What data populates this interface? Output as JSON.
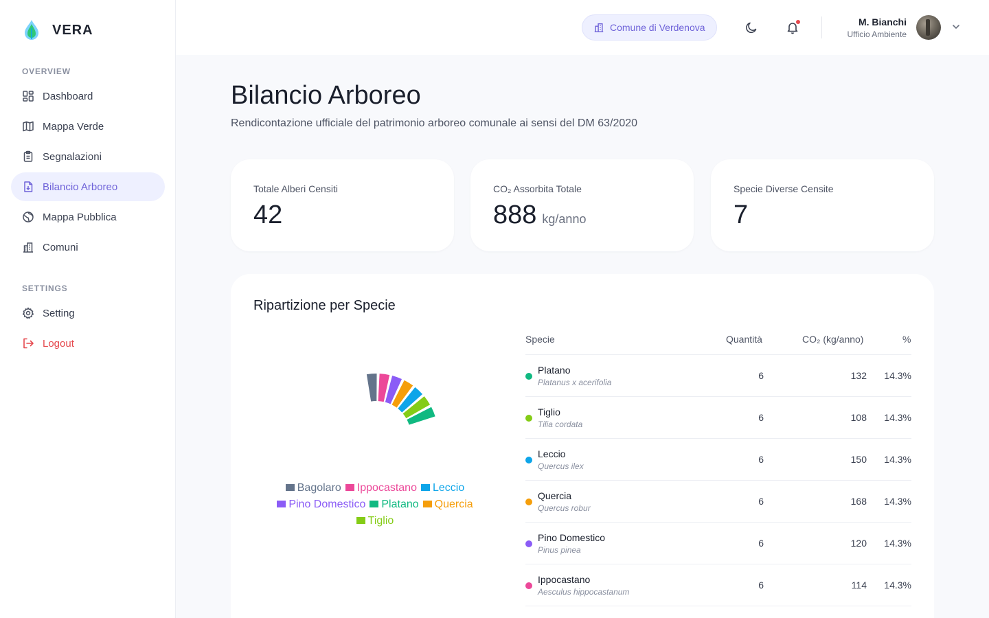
{
  "brand": {
    "name": "VERA"
  },
  "sidebar": {
    "overview_label": "OVERVIEW",
    "settings_label": "SETTINGS",
    "items": [
      {
        "label": "Dashboard",
        "icon": "dashboard-icon"
      },
      {
        "label": "Mappa Verde",
        "icon": "map-icon"
      },
      {
        "label": "Segnalazioni",
        "icon": "clipboard-icon"
      },
      {
        "label": "Bilancio Arboreo",
        "icon": "document-icon",
        "active": true
      },
      {
        "label": "Mappa Pubblica",
        "icon": "globe-icon"
      },
      {
        "label": "Comuni",
        "icon": "building-icon"
      }
    ],
    "settings_items": [
      {
        "label": "Setting",
        "icon": "gear-icon"
      },
      {
        "label": "Logout",
        "icon": "logout-icon"
      }
    ]
  },
  "header": {
    "comune": "Comune di Verdenova",
    "user_name": "M. Bianchi",
    "user_role": "Ufficio Ambiente"
  },
  "page": {
    "title": "Bilancio Arboreo",
    "subtitle": "Rendicontazione ufficiale del patrimonio arboreo comunale ai sensi del DM 63/2020"
  },
  "stats": [
    {
      "label": "Totale Alberi Censiti",
      "value": "42",
      "unit": ""
    },
    {
      "label": "CO₂ Assorbita Totale",
      "value": "888",
      "unit": "kg/anno"
    },
    {
      "label": "Specie Diverse Censite",
      "value": "7",
      "unit": ""
    }
  ],
  "panel": {
    "title": "Ripartizione per Specie"
  },
  "table": {
    "headers": {
      "species": "Specie",
      "qty": "Quantità",
      "co2": "CO₂ (kg/anno)",
      "pct": "%"
    },
    "rows": [
      {
        "name": "Platano",
        "latin": "Platanus x acerifolia",
        "qty": "6",
        "co2": "132",
        "pct": "14.3%",
        "color": "#10b981"
      },
      {
        "name": "Tiglio",
        "latin": "Tilia cordata",
        "qty": "6",
        "co2": "108",
        "pct": "14.3%",
        "color": "#84cc16"
      },
      {
        "name": "Leccio",
        "latin": "Quercus ilex",
        "qty": "6",
        "co2": "150",
        "pct": "14.3%",
        "color": "#0ea5e9"
      },
      {
        "name": "Quercia",
        "latin": "Quercus robur",
        "qty": "6",
        "co2": "168",
        "pct": "14.3%",
        "color": "#f59e0b"
      },
      {
        "name": "Pino Domestico",
        "latin": "Pinus pinea",
        "qty": "6",
        "co2": "120",
        "pct": "14.3%",
        "color": "#8b5cf6"
      },
      {
        "name": "Ippocastano",
        "latin": "Aesculus hippocastanum",
        "qty": "6",
        "co2": "114",
        "pct": "14.3%",
        "color": "#ec4899"
      }
    ]
  },
  "chart_data": {
    "type": "pie",
    "categories": [
      "Bagolaro",
      "Ippocastano",
      "Pino Domestico",
      "Quercia",
      "Leccio",
      "Tiglio",
      "Platano"
    ],
    "values": [
      6,
      6,
      6,
      6,
      6,
      6,
      6
    ],
    "colors": [
      "#64748b",
      "#ec4899",
      "#8b5cf6",
      "#f59e0b",
      "#0ea5e9",
      "#84cc16",
      "#10b981"
    ],
    "legend": [
      {
        "label": "Bagolaro",
        "color": "#64748b"
      },
      {
        "label": "Ippocastano",
        "color": "#ec4899"
      },
      {
        "label": "Leccio",
        "color": "#0ea5e9"
      },
      {
        "label": "Pino Domestico",
        "color": "#8b5cf6"
      },
      {
        "label": "Platano",
        "color": "#10b981"
      },
      {
        "label": "Quercia",
        "color": "#f59e0b"
      },
      {
        "label": "Tiglio",
        "color": "#84cc16"
      }
    ],
    "legend_position": "bottom"
  }
}
